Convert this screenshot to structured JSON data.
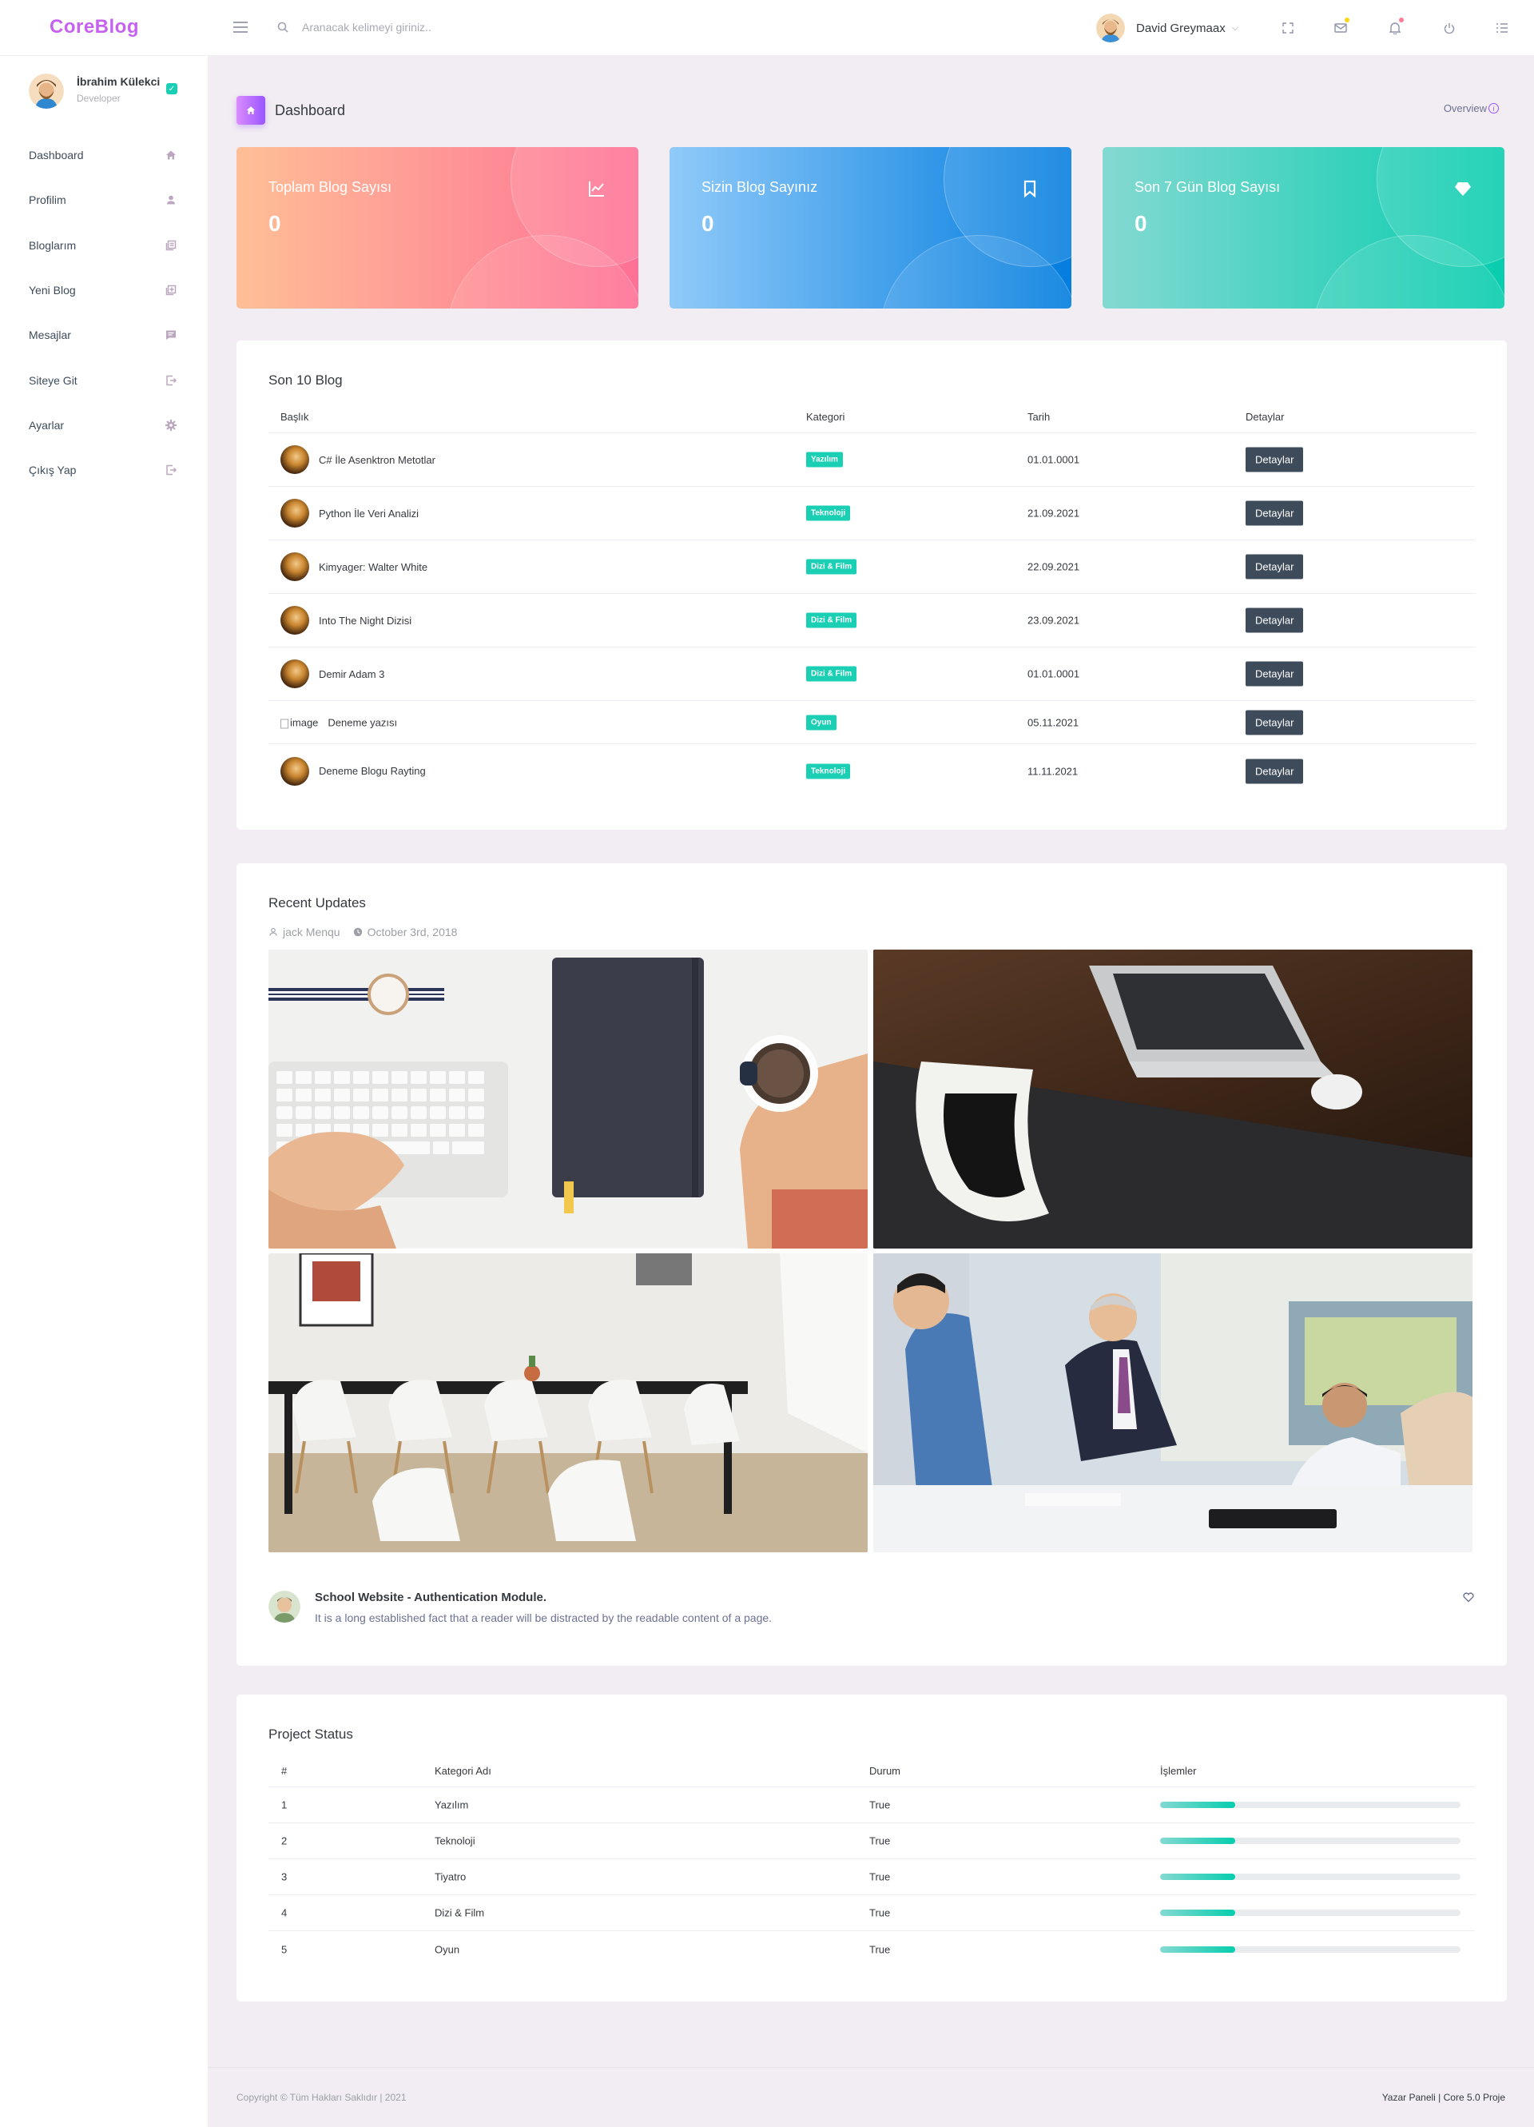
{
  "brand": "CoreBlog",
  "navbar": {
    "search_placeholder": "Aranacak kelimeyi giriniz..",
    "user_name": "David Greymaax",
    "icons": [
      "menu-icon",
      "search-icon",
      "fullscreen-icon",
      "mail-icon",
      "bell-icon",
      "power-icon",
      "list-icon"
    ],
    "mail_dot_color": "#fed713",
    "bell_dot_color": "#fe7c96"
  },
  "sidebar": {
    "profile": {
      "name": "İbrahim Külekci",
      "role": "Developer"
    },
    "items": [
      {
        "label": "Dashboard",
        "icon": "home-icon"
      },
      {
        "label": "Profilim",
        "icon": "user-icon"
      },
      {
        "label": "Bloglarım",
        "icon": "blogs-icon"
      },
      {
        "label": "Yeni Blog",
        "icon": "new-blog-icon"
      },
      {
        "label": "Mesajlar",
        "icon": "message-icon"
      },
      {
        "label": "Siteye Git",
        "icon": "exit-icon"
      },
      {
        "label": "Ayarlar",
        "icon": "settings-icon"
      },
      {
        "label": "Çıkış Yap",
        "icon": "logout-icon"
      }
    ]
  },
  "page_header": {
    "title": "Dashboard",
    "overview": "Overview"
  },
  "stats": [
    {
      "title": "Toplam Blog Sayısı",
      "value": "0",
      "icon": "chart-line-icon",
      "gradient": [
        "#ffbf96",
        "#fe7096"
      ]
    },
    {
      "title": "Sizin Blog Sayınız",
      "value": "0",
      "icon": "bookmark-icon",
      "gradient": [
        "#90caf9",
        "#047edf"
      ]
    },
    {
      "title": "Son 7 Gün Blog Sayısı",
      "value": "0",
      "icon": "diamond-icon",
      "gradient": [
        "#84d9d2",
        "#07cdae"
      ]
    }
  ],
  "blog_table": {
    "title": "Son 10 Blog",
    "headers": [
      "Başlık",
      "Kategori",
      "Tarih",
      "Detaylar"
    ],
    "button_label": "Detaylar",
    "rows": [
      {
        "title": "C# İle Asenktron Metotlar",
        "category": "Yazılım",
        "date": "01.01.0001",
        "image": "avatar"
      },
      {
        "title": "Python İle Veri Analizi",
        "category": "Teknoloji",
        "date": "21.09.2021",
        "image": "avatar"
      },
      {
        "title": "Kimyager: Walter White",
        "category": "Dizi & Film",
        "date": "22.09.2021",
        "image": "avatar"
      },
      {
        "title": "Into The Night Dizisi",
        "category": "Dizi & Film",
        "date": "23.09.2021",
        "image": "avatar"
      },
      {
        "title": "Demir Adam 3",
        "category": "Dizi & Film",
        "date": "01.01.0001",
        "image": "avatar"
      },
      {
        "title": "Deneme yazısı",
        "category": "Oyun",
        "date": "05.11.2021",
        "image": "broken",
        "image_alt": "image"
      },
      {
        "title": "Deneme Blogu Rayting",
        "category": "Teknoloji",
        "date": "11.11.2021",
        "image": "avatar"
      }
    ]
  },
  "updates": {
    "title": "Recent Updates",
    "author": "jack Menqu",
    "date": "October 3rd, 2018",
    "photos": [
      "workspace-keyboard-coffee",
      "laptop-on-desk",
      "meeting-room-chairs",
      "office-meeting"
    ],
    "post_title": "School Website - Authentication Module.",
    "post_desc": "It is a long established fact that a reader will be distracted by the readable content of a page."
  },
  "project_status": {
    "title": "Project Status",
    "headers": [
      "#",
      "Kategori Adı",
      "Durum",
      "İşlemler"
    ],
    "rows": [
      {
        "num": "1",
        "name": "Yazılım",
        "status": "True",
        "progress": 0.25
      },
      {
        "num": "2",
        "name": "Teknoloji",
        "status": "True",
        "progress": 0.25
      },
      {
        "num": "3",
        "name": "Tiyatro",
        "status": "True",
        "progress": 0.25
      },
      {
        "num": "4",
        "name": "Dizi & Film",
        "status": "True",
        "progress": 0.25
      },
      {
        "num": "5",
        "name": "Oyun",
        "status": "True",
        "progress": 0.25
      }
    ]
  },
  "footer": {
    "left": "Copyright © Tüm Hakları Saklıdır | 2021",
    "right": "Yazar Paneli | Core 5.0 Proje"
  },
  "colors": {
    "accent": "#c761f0",
    "teal": "#1bcfb4",
    "dark_button": "#3e4b5b"
  }
}
